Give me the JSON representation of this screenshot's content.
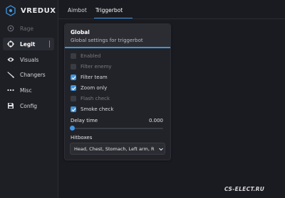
{
  "app": {
    "brand": "VREDUX",
    "accent": "#3d95e4"
  },
  "sidebar": {
    "items": [
      {
        "label": "Rage",
        "icon": "target-icon",
        "state": "disabled"
      },
      {
        "label": "Legit",
        "icon": "crosshair-icon",
        "state": "active"
      },
      {
        "label": "Visuals",
        "icon": "eye-icon",
        "state": "normal"
      },
      {
        "label": "Changers",
        "icon": "knife-icon",
        "state": "normal"
      },
      {
        "label": "Misc",
        "icon": "dots-icon",
        "state": "normal"
      },
      {
        "label": "Config",
        "icon": "save-icon",
        "state": "normal"
      }
    ]
  },
  "tabs": [
    {
      "label": "Aimbot",
      "active": false
    },
    {
      "label": "Triggerbot",
      "active": true
    }
  ],
  "panel": {
    "title": "Global",
    "subtitle": "Global settings for triggerbot",
    "options": [
      {
        "label": "Enabled",
        "checked": false,
        "disabled": true
      },
      {
        "label": "Filter enemy",
        "checked": false,
        "disabled": true
      },
      {
        "label": "Filter team",
        "checked": true,
        "disabled": false
      },
      {
        "label": "Zoom only",
        "checked": true,
        "disabled": false
      },
      {
        "label": "Flash check",
        "checked": false,
        "disabled": true
      },
      {
        "label": "Smoke check",
        "checked": true,
        "disabled": false
      }
    ],
    "delay": {
      "label": "Delay time",
      "value": "0.000"
    },
    "hitboxes": {
      "label": "Hitboxes",
      "selected": "Head, Chest, Stomach, Left arm, R"
    }
  },
  "watermark": "CS-ELECT.RU"
}
